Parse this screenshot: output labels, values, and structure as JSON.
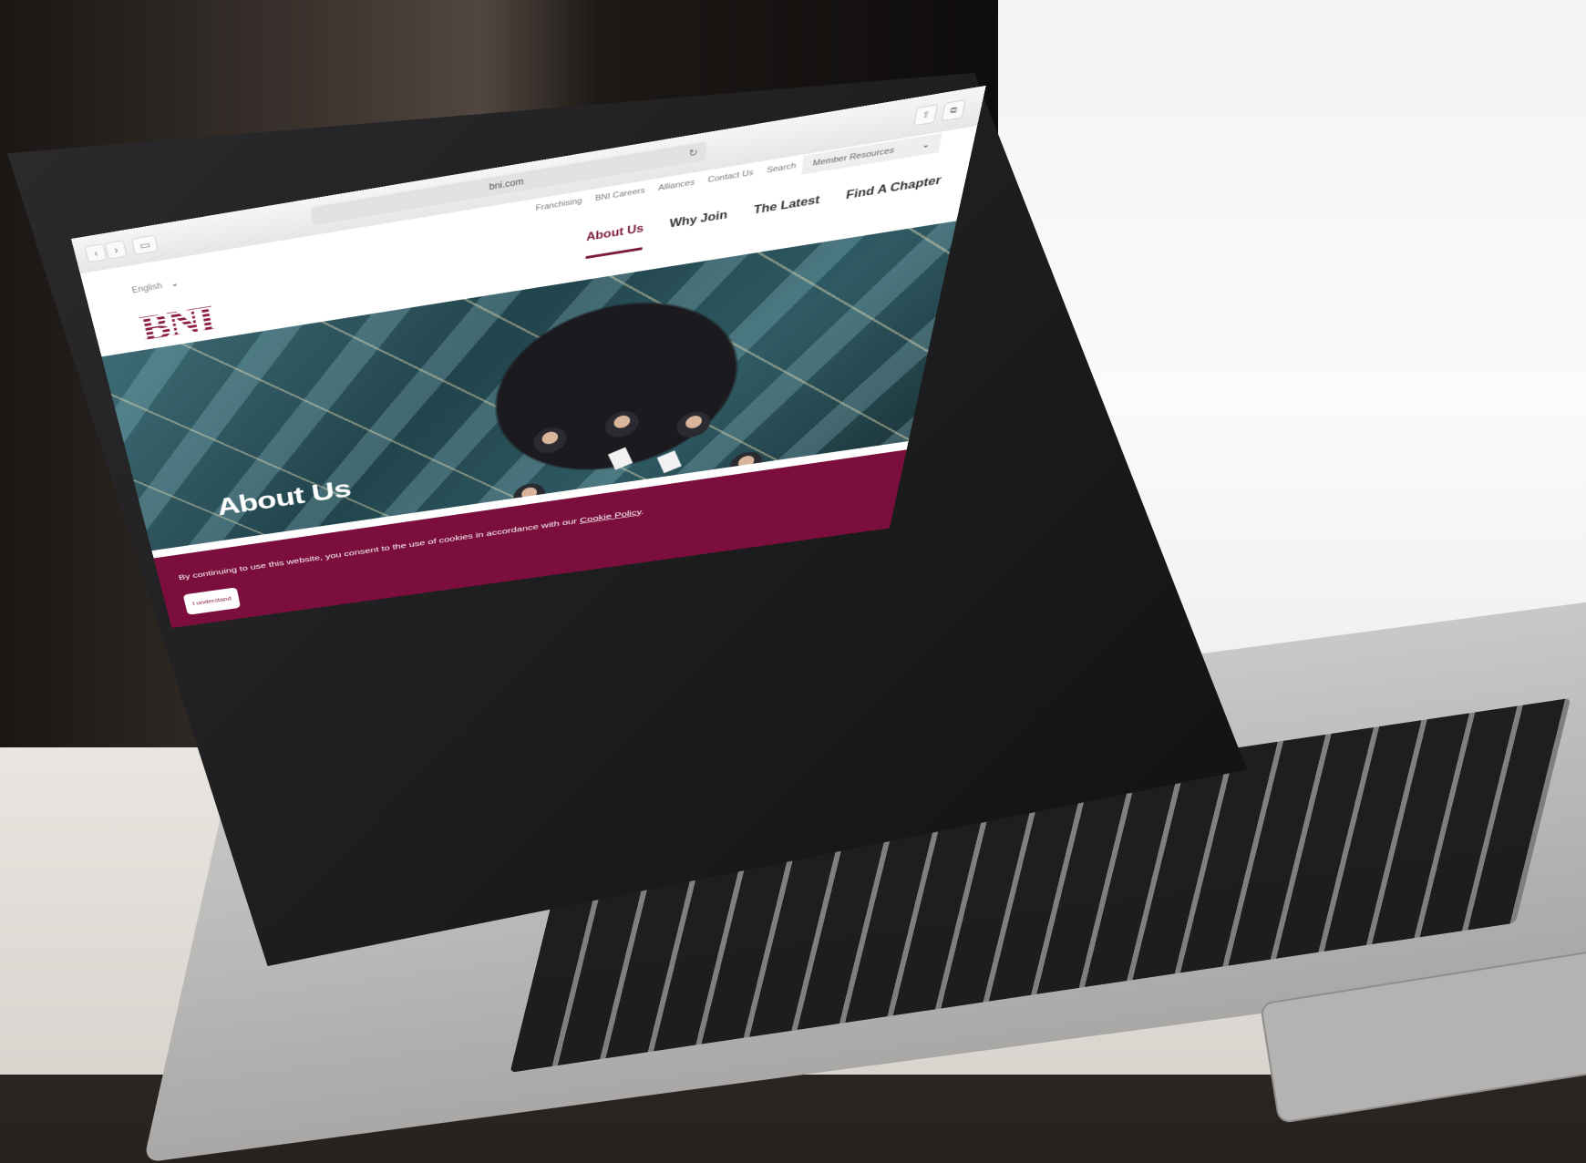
{
  "browser": {
    "url": "bni.com",
    "back_icon": "chevron-left-icon",
    "forward_icon": "chevron-right-icon",
    "reload_icon": "reload-icon"
  },
  "header": {
    "utility_links": [
      "Franchising",
      "BNI Careers",
      "Alliances",
      "Contact Us",
      "Search"
    ],
    "member_resources": "Member Resources",
    "language": "English",
    "logo": "BNI",
    "main_nav": [
      "About Us",
      "Why Join",
      "The Latest",
      "Find A Chapter"
    ],
    "active_nav": "About Us"
  },
  "hero": {
    "title": "About Us"
  },
  "cookie_banner": {
    "text": "By continuing to use this website, you consent to the use of cookies in accordance with our",
    "link": "Cookie Policy",
    "link_suffix": ".",
    "button": "I understand"
  },
  "colors": {
    "brand": "#7b0e3c",
    "nav_active": "#7b1a3a"
  }
}
